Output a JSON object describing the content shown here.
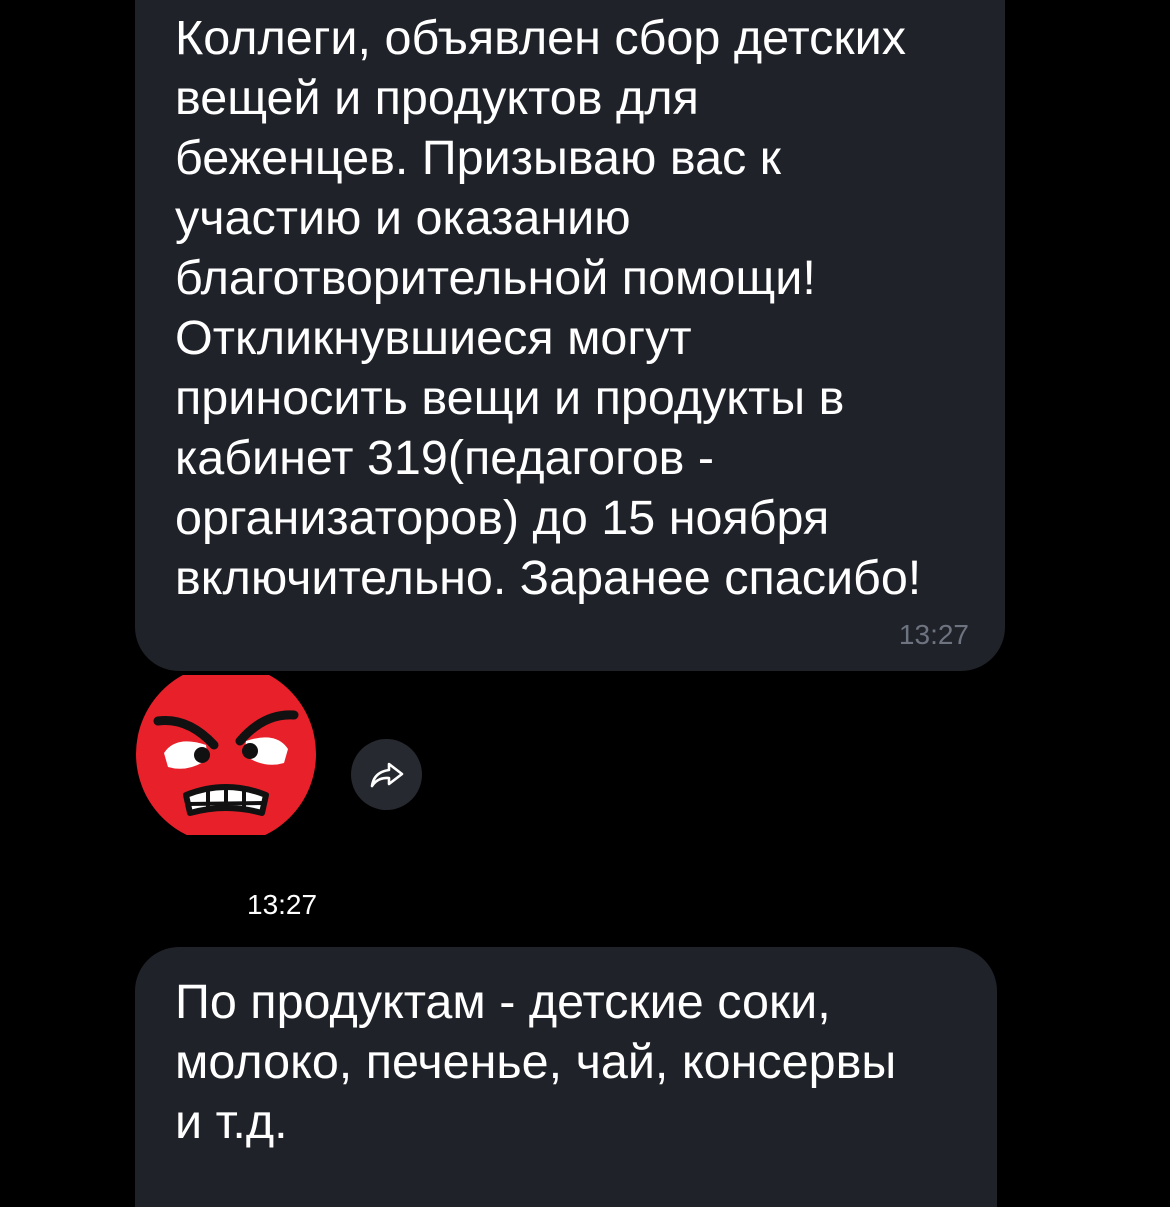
{
  "messages": [
    {
      "lines": [
        "Коллеги, объявлен сбор детских",
        "вещей и продуктов для",
        "беженцев. Призываю вас к",
        "участию и оказанию",
        "благотворительной помощи!",
        "Откликнувшиеся могут",
        "приносить вещи и продукты в",
        "кабинет 319(педагогов -",
        "организаторов) до 15 ноября",
        "включительно. Заранее спасибо!"
      ],
      "time": "13:27"
    },
    {
      "lines": [
        "По продуктам - детские соки,",
        "молоко, печенье, чай, консервы",
        "и т.д."
      ]
    }
  ],
  "sticker": {
    "icon": "angry-face-sticker",
    "time": "13:27"
  },
  "share": {
    "icon": "share-arrow-icon"
  },
  "colors": {
    "background": "#000000",
    "bubble": "#1f2228",
    "text": "#ffffff",
    "time_muted": "#6e7380",
    "sticker_red": "#e8202a",
    "share_button": "#262930"
  }
}
